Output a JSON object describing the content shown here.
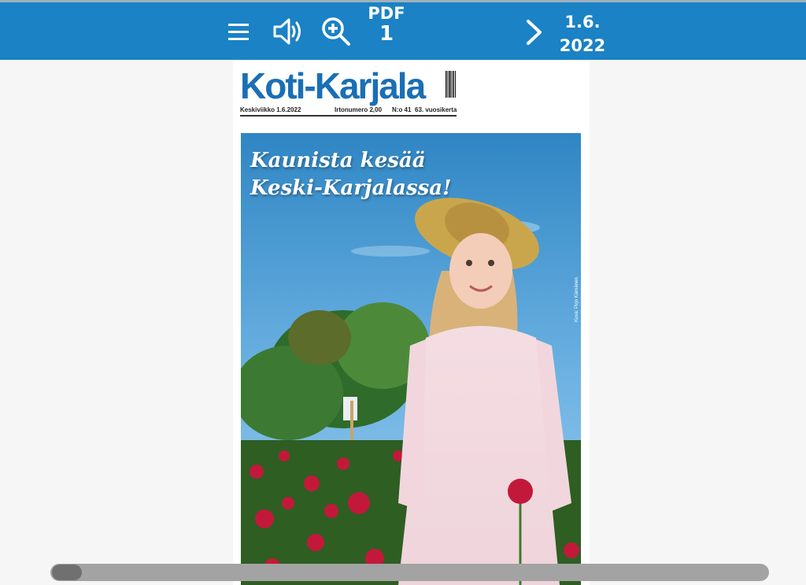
{
  "toolbar": {
    "menu_icon": "hamburger-menu-icon",
    "sound_icon": "speaker-icon",
    "zoom_icon": "zoom-in-icon",
    "pdf_label": "PDF",
    "page_number": "1",
    "next_icon": "chevron-right-icon",
    "date_line1": "1.6.",
    "date_line2": "2022",
    "background_color": "#1a82c5"
  },
  "newspaper": {
    "masthead": "Koti-Karjala",
    "date_text": "Keskiviikko 1.6.2022",
    "price_text": "Irtonumero 2,00",
    "issue_text": "N:o 41",
    "volume_text": "63. vuosikerta",
    "headline_line1": "Kaunista kesää",
    "headline_line2": "Keski-Karjalassa!",
    "photo_credit": "Kuva: Pirjo Kärnänen",
    "brand_color": "#1a6fb5"
  },
  "scrollbar": {
    "position_fraction": 0.0
  }
}
